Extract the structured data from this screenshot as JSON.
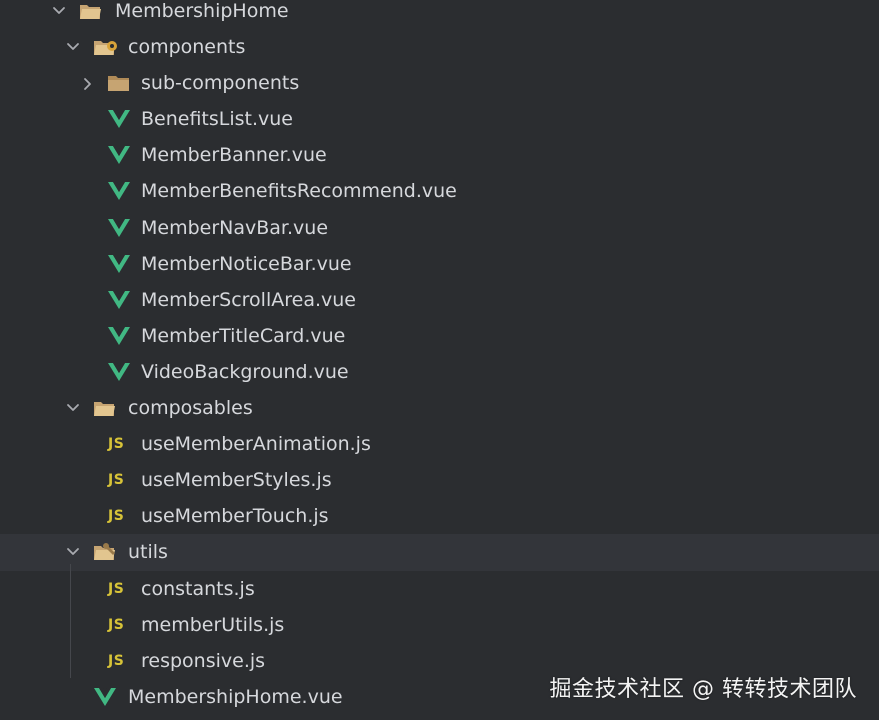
{
  "tree": {
    "root": {
      "label": "MembershipHome",
      "icon": "folder-open-icon",
      "expanded": true
    },
    "components": {
      "label": "components",
      "icon": "folder-open-icon",
      "expanded": true
    },
    "sub_components": {
      "label": "sub-components",
      "icon": "folder-icon",
      "expanded": false
    },
    "component_files": [
      {
        "label": "BenefitsList.vue",
        "icon": "vue-icon"
      },
      {
        "label": "MemberBanner.vue",
        "icon": "vue-icon"
      },
      {
        "label": "MemberBenefitsRecommend.vue",
        "icon": "vue-icon"
      },
      {
        "label": "MemberNavBar.vue",
        "icon": "vue-icon"
      },
      {
        "label": "MemberNoticeBar.vue",
        "icon": "vue-icon"
      },
      {
        "label": "MemberScrollArea.vue",
        "icon": "vue-icon"
      },
      {
        "label": "MemberTitleCard.vue",
        "icon": "vue-icon"
      },
      {
        "label": "VideoBackground.vue",
        "icon": "vue-icon"
      }
    ],
    "composables": {
      "label": "composables",
      "icon": "folder-open-icon",
      "expanded": true
    },
    "composable_files": [
      {
        "label": "useMemberAnimation.js",
        "icon": "js-icon"
      },
      {
        "label": "useMemberStyles.js",
        "icon": "js-icon"
      },
      {
        "label": "useMemberTouch.js",
        "icon": "js-icon"
      }
    ],
    "utils": {
      "label": "utils",
      "icon": "folder-open-icon",
      "expanded": true,
      "selected": true
    },
    "utils_files": [
      {
        "label": "constants.js",
        "icon": "js-icon"
      },
      {
        "label": "memberUtils.js",
        "icon": "js-icon"
      },
      {
        "label": "responsive.js",
        "icon": "js-icon"
      }
    ],
    "root_file": {
      "label": "MembershipHome.vue",
      "icon": "vue-icon"
    }
  },
  "js_icon_text": "JS",
  "watermark": "掘金技术社区 @ 转转技术团队",
  "colors": {
    "background": "#2b2d30",
    "selected_row": "#33353a",
    "text": "#d6d8dc",
    "folder": "#c6a472",
    "vue_green": "#41b883",
    "js_yellow": "#d7c338"
  }
}
